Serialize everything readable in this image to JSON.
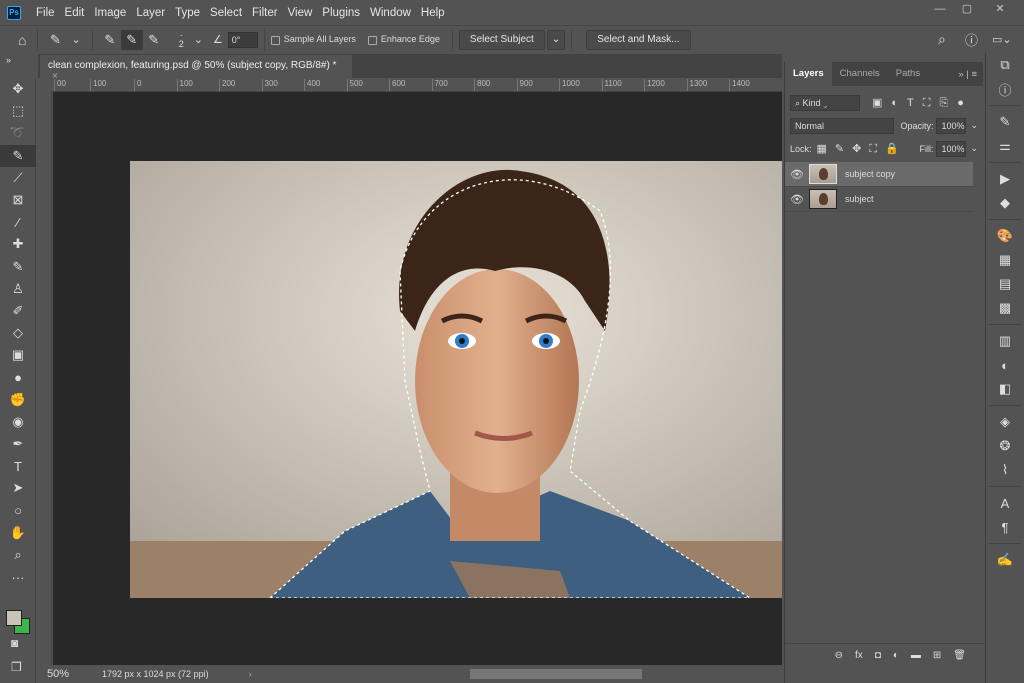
{
  "menu": [
    "File",
    "Edit",
    "Image",
    "Layer",
    "Type",
    "Select",
    "Filter",
    "View",
    "Plugins",
    "Window",
    "Help"
  ],
  "app_logo": "Ps",
  "window_controls": {
    "minimize": "—",
    "maximize": "▢",
    "close": "✕"
  },
  "options": {
    "brush_size": "2",
    "angle": "0°",
    "sample_all_layers": "Sample All Layers",
    "enhance_edge": "Enhance Edge",
    "select_subject": "Select Subject",
    "select_and_mask": "Select and Mask...",
    "sample_all_checked": false,
    "enhance_edge_checked": false
  },
  "document_tab": {
    "title": "clean complexion, featuring.psd @ 50% (subject copy, RGB/8#) *",
    "close": "×"
  },
  "ruler_labels": [
    "00",
    "100",
    "0",
    "100",
    "200",
    "300",
    "400",
    "500",
    "600",
    "700",
    "800",
    "900",
    "1000",
    "1100",
    "1200",
    "1300",
    "1400"
  ],
  "status": {
    "zoom": "50%",
    "doc_info": "1792 px x 1024 px (72 ppi)"
  },
  "layers_panel": {
    "tabs": [
      "Layers",
      "Channels",
      "Paths"
    ],
    "filter_kind": "Kind",
    "blend_mode": "Normal",
    "opacity_label": "Opacity:",
    "opacity": "100%",
    "lock_label": "Lock:",
    "fill_label": "Fill:",
    "fill": "100%",
    "layers": [
      {
        "name": "subject copy",
        "visible": true,
        "selected": true
      },
      {
        "name": "subject",
        "visible": true,
        "selected": false
      }
    ]
  },
  "colors": {
    "foreground": "#c8c4b8",
    "background": "#3cb54a",
    "accent": "#31a8ff"
  }
}
